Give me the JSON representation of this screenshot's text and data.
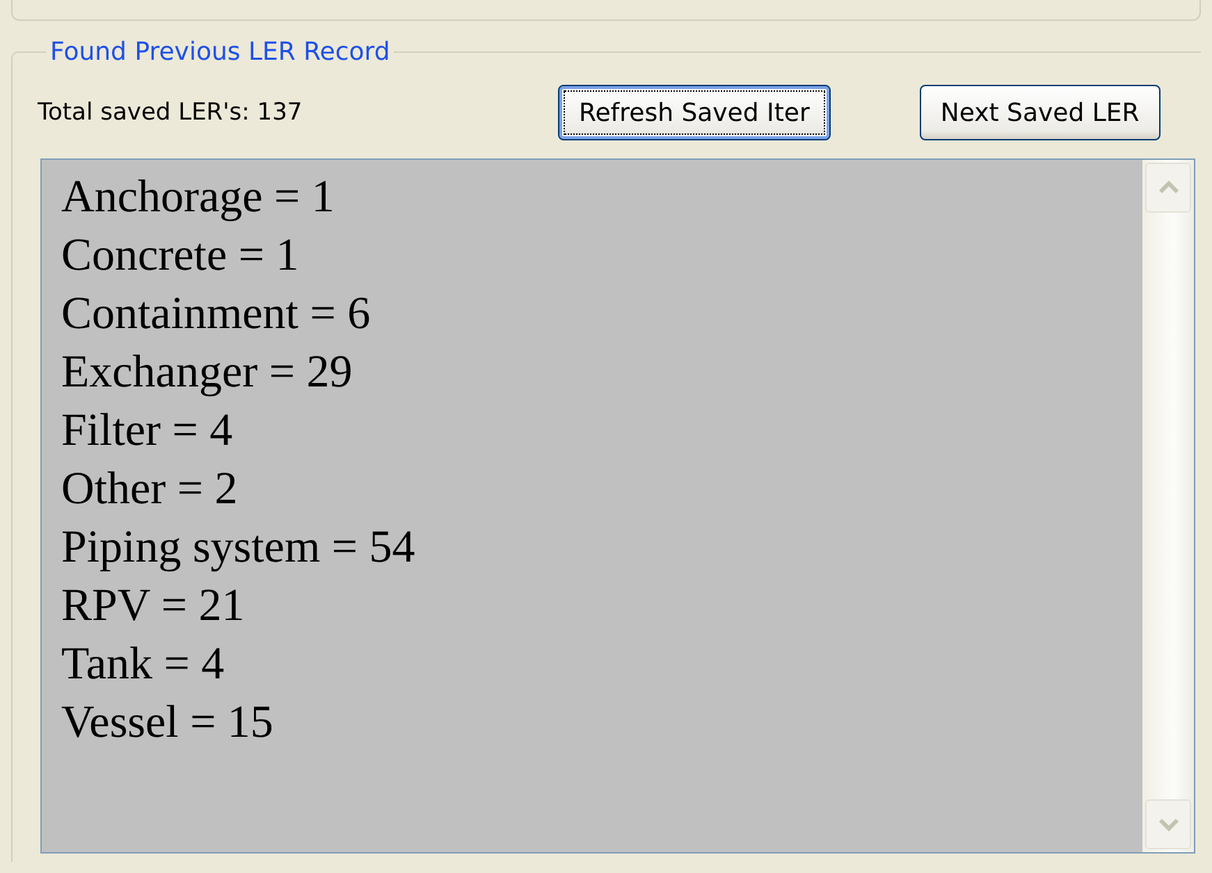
{
  "group": {
    "title": "Found Previous LER Record"
  },
  "total_label": "Total saved LER's: 137",
  "buttons": [
    {
      "label": "Refresh Saved Iter",
      "focused": true
    },
    {
      "label": "Next Saved LER",
      "focused": false
    }
  ],
  "list": {
    "lines": [
      "Anchorage = 1",
      "Concrete = 1",
      "Containment = 6",
      "Exchanger = 29",
      "Filter = 4",
      "Other = 2",
      "Piping system = 54",
      "RPV = 21",
      "Tank = 4",
      "Vessel = 15"
    ]
  }
}
